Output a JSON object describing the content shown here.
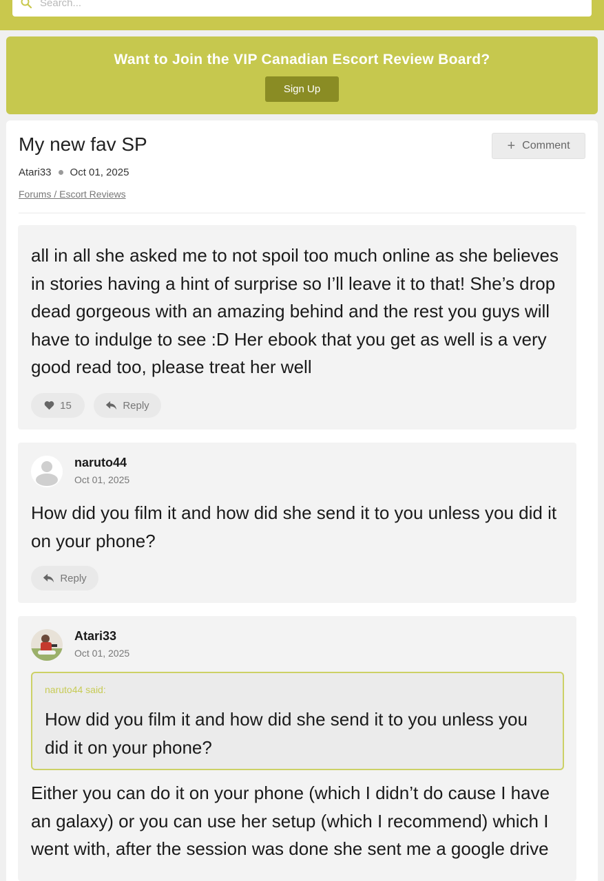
{
  "search": {
    "placeholder": "Search..."
  },
  "banner": {
    "title": "Want to Join the VIP Canadian Escort Review Board?",
    "signup_label": "Sign Up"
  },
  "post": {
    "title": "My new fav SP",
    "author": "Atari33",
    "date": "Oct 01, 2025",
    "breadcrumb": "Forums / Escort Reviews",
    "comment_label": "Comment"
  },
  "comments": [
    {
      "lines": [
        "all in all she asked me to not spoil too much online as she believes",
        "in stories having a hint of surprise so I’ll leave it to that! She’s drop",
        "dead gorgeous with an amazing behind and the rest you guys will",
        "have to indulge to see :D Her ebook that you get as well is a very",
        "good read too, please treat her well"
      ],
      "likes": "15",
      "reply_label": "Reply"
    },
    {
      "username": "naruto44",
      "date": "Oct 01, 2025",
      "lines": [
        "How did you film it and how did she send it to you unless you did it",
        "on your phone?"
      ],
      "reply_label": "Reply"
    },
    {
      "username": "Atari33",
      "date": "Oct 01, 2025",
      "quote": {
        "said": "naruto44 said:",
        "lines": [
          "How did you film it and how did she send it to you unless you",
          "did it on your phone?"
        ]
      },
      "lines": [
        "Either you can do it on your phone (which I didn’t do cause I have",
        "an galaxy) or you can use her setup (which I recommend) which I",
        "went with, after the session was done she sent me a google drive"
      ]
    }
  ],
  "colors": {
    "accent": "#c9c84d",
    "button_dark": "#8a8c24",
    "quote_border": "#ccd165"
  }
}
